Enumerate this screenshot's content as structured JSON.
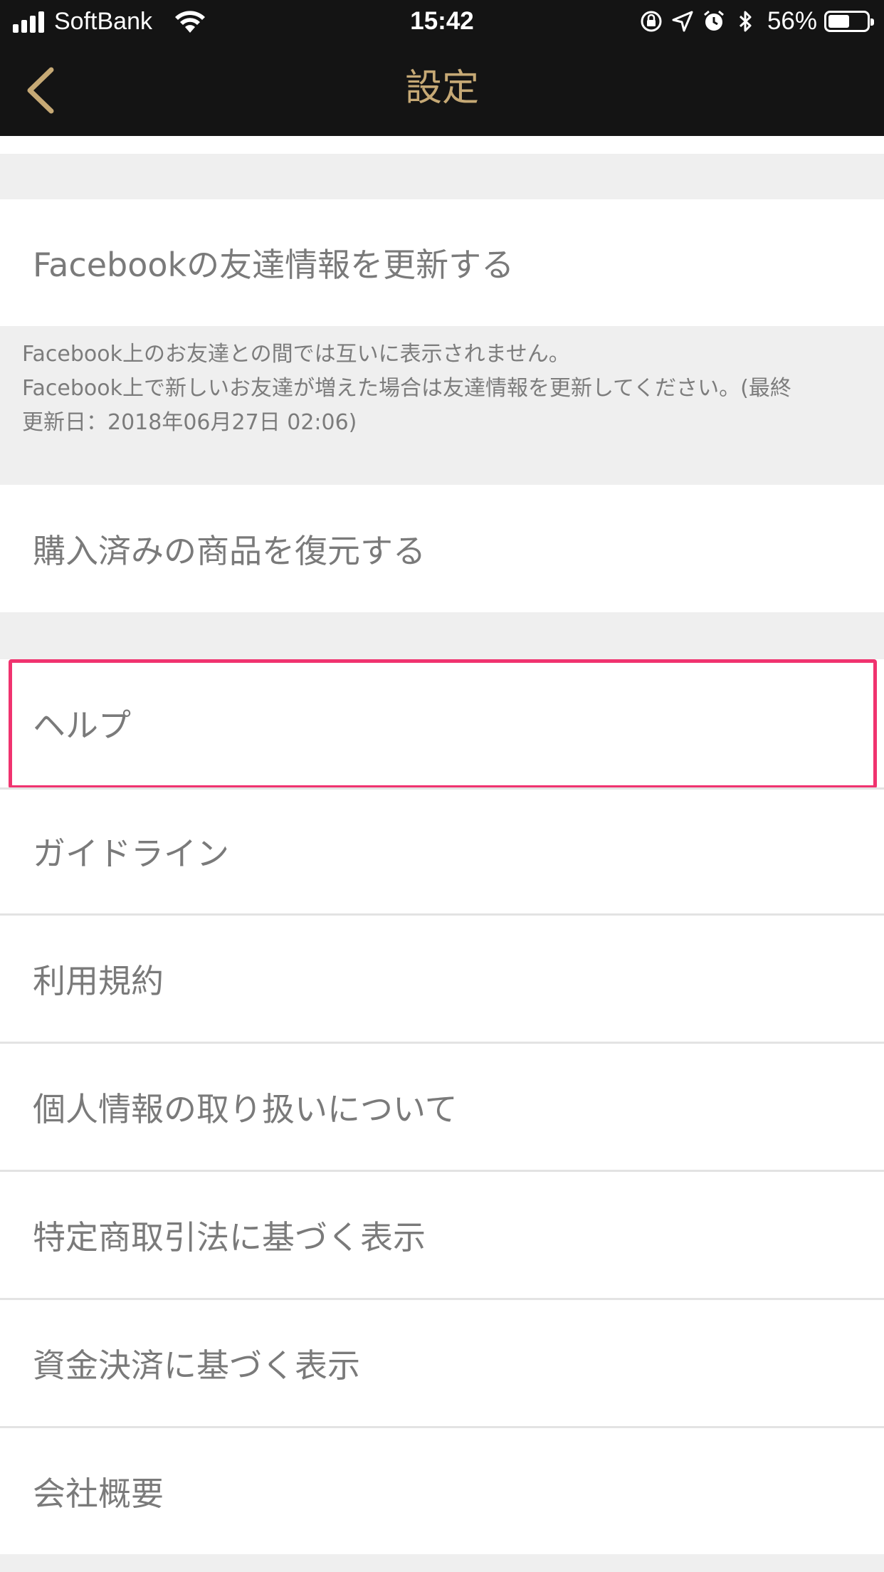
{
  "status_bar": {
    "carrier": "SoftBank",
    "time": "15:42",
    "battery_percent": "56%",
    "battery_level": 0.56,
    "icons": [
      "signal-icon",
      "wifi-icon",
      "orientation-lock-icon",
      "location-icon",
      "alarm-icon",
      "bluetooth-icon",
      "battery-icon"
    ]
  },
  "header": {
    "title": "設定",
    "back_icon": "chevron-left-icon"
  },
  "rows": {
    "facebook_update": "Facebookの友達情報を更新する",
    "restore_purchases": "購入済みの商品を復元する",
    "help": "ヘルプ",
    "guidelines": "ガイドライン",
    "terms": "利用規約",
    "privacy": "個人情報の取り扱いについて",
    "commercial_law": "特定商取引法に基づく表示",
    "payment_law": "資金決済に基づく表示",
    "company": "会社概要"
  },
  "facebook_note": {
    "line1": "Facebook上のお友達との間では互いに表示されません。",
    "line2": "Facebook上で新しいお友達が増えた場合は友達情報を更新してください。(最終",
    "line3": "更新日：2018年06月27日 02:06)"
  },
  "colors": {
    "header_bg": "#141414",
    "accent_gold": "#c6a975",
    "highlight": "#f0336f",
    "row_text": "#7a7a7a",
    "section_bg": "#efefef"
  }
}
